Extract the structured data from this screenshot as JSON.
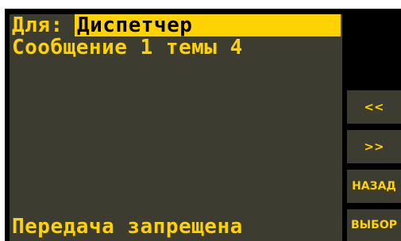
{
  "header": {
    "to_label": "Для:",
    "to_value": "Диспетчер"
  },
  "message": {
    "line": "Сообщение 1 темы 4"
  },
  "status": {
    "text": "Передача запрещена"
  },
  "softkeys": {
    "prev": "<<",
    "next": ">>",
    "back": "НАЗАД",
    "select": "ВЫБОР"
  },
  "colors": {
    "text": "#ffd200",
    "panel": "#3c3c30",
    "frame": "#000000"
  }
}
